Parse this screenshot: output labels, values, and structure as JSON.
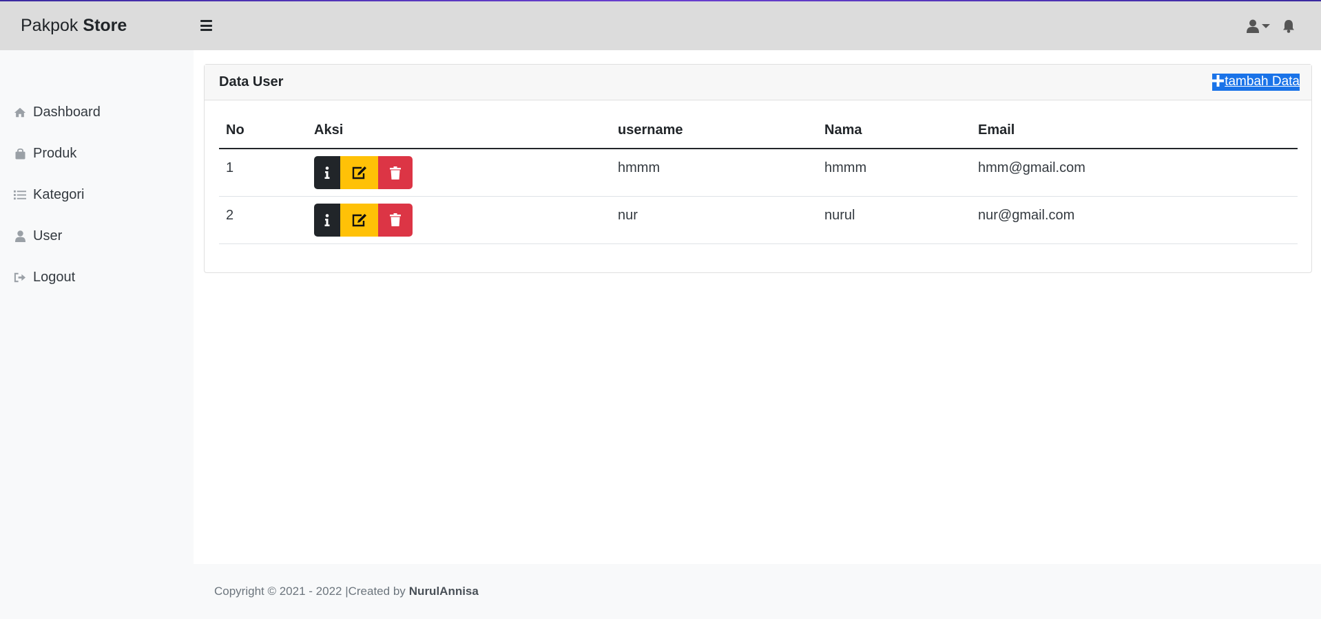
{
  "navbar": {
    "brand_light": "Pakpok",
    "brand_bold": "Store",
    "menu_toggle_icon": "hamburger-icon",
    "user_icon": "user-icon",
    "notification_icon": "bell-icon"
  },
  "sidebar": {
    "items": [
      {
        "label": "Dashboard",
        "icon": "home-icon"
      },
      {
        "label": "Produk",
        "icon": "shopping-bag-icon"
      },
      {
        "label": "Kategori",
        "icon": "list-icon"
      },
      {
        "label": "User",
        "icon": "user-icon"
      },
      {
        "label": "Logout",
        "icon": "sign-out-icon"
      }
    ]
  },
  "card": {
    "title": "Data User",
    "add_button_icon": "plus-icon",
    "add_button_label": " tambah Data"
  },
  "table": {
    "headers": [
      "No",
      "Aksi",
      "username",
      "Nama",
      "Email"
    ],
    "rows": [
      {
        "no": "1",
        "username": "hmmm",
        "nama": "hmmm",
        "email": "hmm@gmail.com"
      },
      {
        "no": "2",
        "username": "nur",
        "nama": "nurul",
        "email": "nur@gmail.com"
      }
    ],
    "action_icons": [
      "info-icon",
      "edit-icon",
      "trash-icon"
    ]
  },
  "footer": {
    "copyright": "Copyright © 2021 - 2022 |Created by",
    "author": "NurulAnnisa"
  },
  "colors": {
    "navbar_bg": "#dcdcdc",
    "sidebar_bg": "#f8f9fa",
    "info_btn": "#212529",
    "edit_btn": "#ffc107",
    "delete_btn": "#dc3545",
    "add_link_bg": "#1a73e8"
  }
}
